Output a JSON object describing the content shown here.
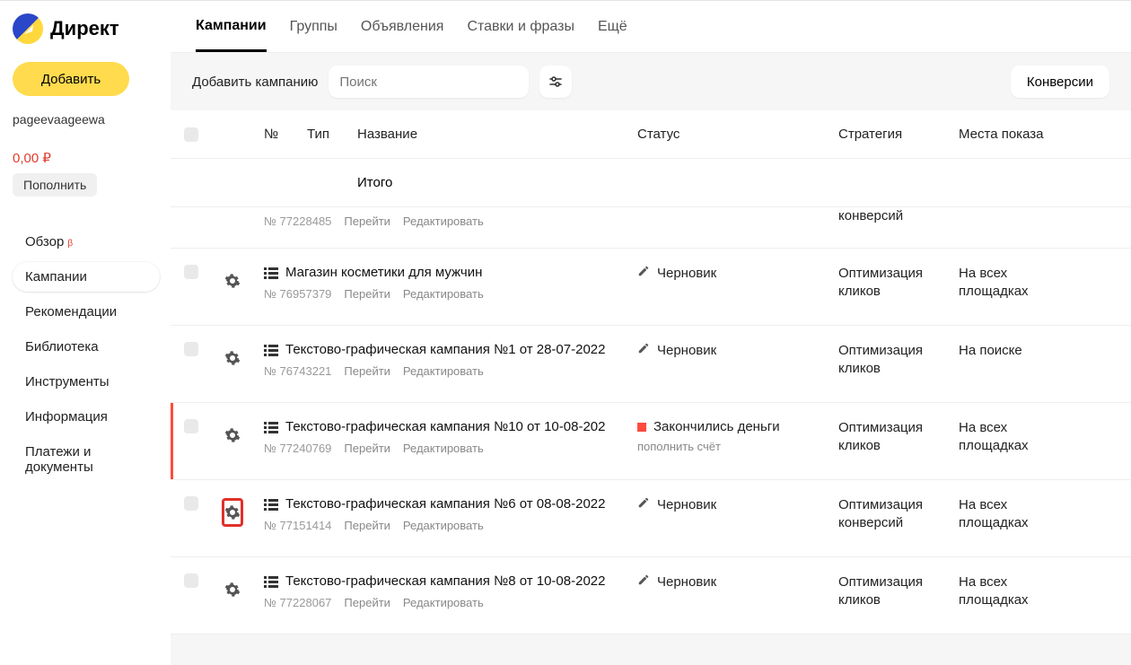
{
  "app_name": "Директ",
  "sidebar": {
    "add_button": "Добавить",
    "username": "pageevaageewa",
    "balance": "0,00 ₽",
    "topup": "Пополнить",
    "nav": [
      {
        "label": "Обзор",
        "beta": "β"
      },
      {
        "label": "Кампании"
      },
      {
        "label": "Рекомендации"
      },
      {
        "label": "Библиотека"
      },
      {
        "label": "Инструменты"
      },
      {
        "label": "Информация"
      },
      {
        "label": "Платежи и документы"
      }
    ]
  },
  "tabs": [
    "Кампании",
    "Группы",
    "Объявления",
    "Ставки и фразы",
    "Ещё"
  ],
  "toolbar": {
    "add_campaign": "Добавить кампанию",
    "search_placeholder": "Поиск",
    "conversions": "Конверсии"
  },
  "columns": {
    "no": "№",
    "type": "Тип",
    "name": "Название",
    "status": "Статус",
    "strategy": "Стратегия",
    "placement": "Места показа"
  },
  "total_label": "Итого",
  "labels": {
    "go": "Перейти",
    "edit": "Редактировать",
    "no_prefix": "№ "
  },
  "rows": [
    {
      "partial": true,
      "no": "77228485",
      "strategy": "конверсий"
    },
    {
      "title": "Магазин косметики для мужчин",
      "no": "76957379",
      "status_kind": "draft",
      "status": "Черновик",
      "strategy": "Оптимизация кликов",
      "placement": "На всех площадках"
    },
    {
      "title": "Текстово-графическая кампания №1 от 28-07-2022",
      "no": "76743221",
      "status_kind": "draft",
      "status": "Черновик",
      "strategy": "Оптимизация кликов",
      "placement": "На поиске"
    },
    {
      "title": "Текстово-графическая кампания №10 от 10-08-202",
      "no": "77240769",
      "status_kind": "nomoney",
      "status": "Закончились деньги",
      "sub_status": "пополнить счёт",
      "red_bar": true,
      "strategy": "Оптимизация кликов",
      "placement": "На всех площадках"
    },
    {
      "title": "Текстово-графическая кампания №6 от 08-08-2022",
      "no": "77151414",
      "status_kind": "draft",
      "status": "Черновик",
      "highlight_gear": true,
      "strategy": "Оптимизация конверсий",
      "placement": "На всех площадках"
    },
    {
      "title": "Текстово-графическая кампания №8 от 10-08-2022",
      "no": "77228067",
      "status_kind": "draft",
      "status": "Черновик",
      "strategy": "Оптимизация кликов",
      "placement": "На всех площадках"
    }
  ]
}
